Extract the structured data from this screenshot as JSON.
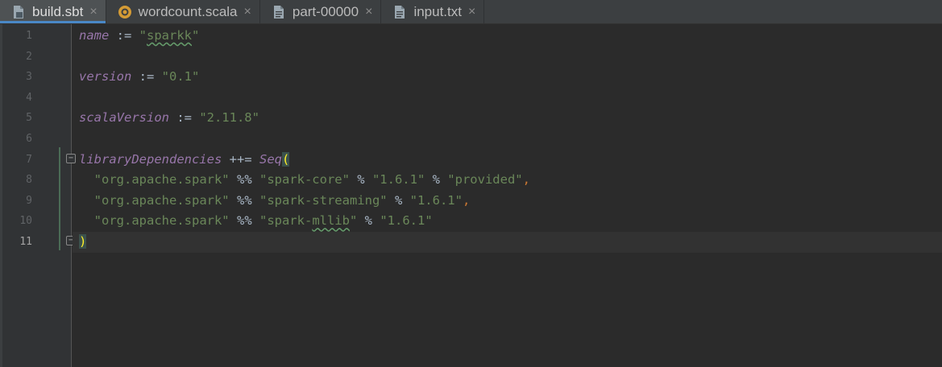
{
  "tabs": [
    {
      "label": "build.sbt",
      "icon": "sbt-file-icon",
      "active": true
    },
    {
      "label": "wordcount.scala",
      "icon": "scala-object-icon",
      "active": false
    },
    {
      "label": "part-00000",
      "icon": "text-file-icon",
      "active": false
    },
    {
      "label": "input.txt",
      "icon": "text-file-icon",
      "active": false
    }
  ],
  "close_glyph": "×",
  "line_numbers": [
    "1",
    "2",
    "3",
    "4",
    "5",
    "6",
    "7",
    "8",
    "9",
    "10",
    "11"
  ],
  "current_line": 11,
  "code": {
    "l1": {
      "id": "name",
      "op": " := ",
      "q1": "\"",
      "squiggle": "sparkk",
      "q2": "\""
    },
    "l3": {
      "id": "version",
      "op": " := ",
      "str": "\"0.1\""
    },
    "l5": {
      "id": "scalaVersion",
      "op": " := ",
      "str": "\"2.11.8\""
    },
    "l7": {
      "id": "libraryDependencies",
      "op": " ++= ",
      "fn": "Seq",
      "paren": "("
    },
    "l8": {
      "indent": "  ",
      "s1": "\"org.apache.spark\"",
      "o1": " %% ",
      "s2": "\"spark-core\"",
      "o2": " % ",
      "s3": "\"1.6.1\"",
      "o3": " % ",
      "s4": "\"provided\"",
      "comma": ","
    },
    "l9": {
      "indent": "  ",
      "s1": "\"org.apache.spark\"",
      "o1": " %% ",
      "s2": "\"spark-streaming\"",
      "o2": " % ",
      "s3": "\"1.6.1\"",
      "comma": ","
    },
    "l10": {
      "indent": "  ",
      "s1": "\"org.apache.spark\"",
      "o1": " %% ",
      "s2a": "\"spark-",
      "squiggle": "mllib",
      "s2b": "\"",
      "o2": " % ",
      "s3": "\"1.6.1\""
    },
    "l11": {
      "paren": ")"
    }
  },
  "colors": {
    "background": "#2b2b2b",
    "tabbar": "#3c3f41",
    "active_tab": "#4e5254",
    "identifier": "#9876aa",
    "string": "#6a8759",
    "comma": "#cc7832",
    "brace_highlight": "#ffef28"
  }
}
